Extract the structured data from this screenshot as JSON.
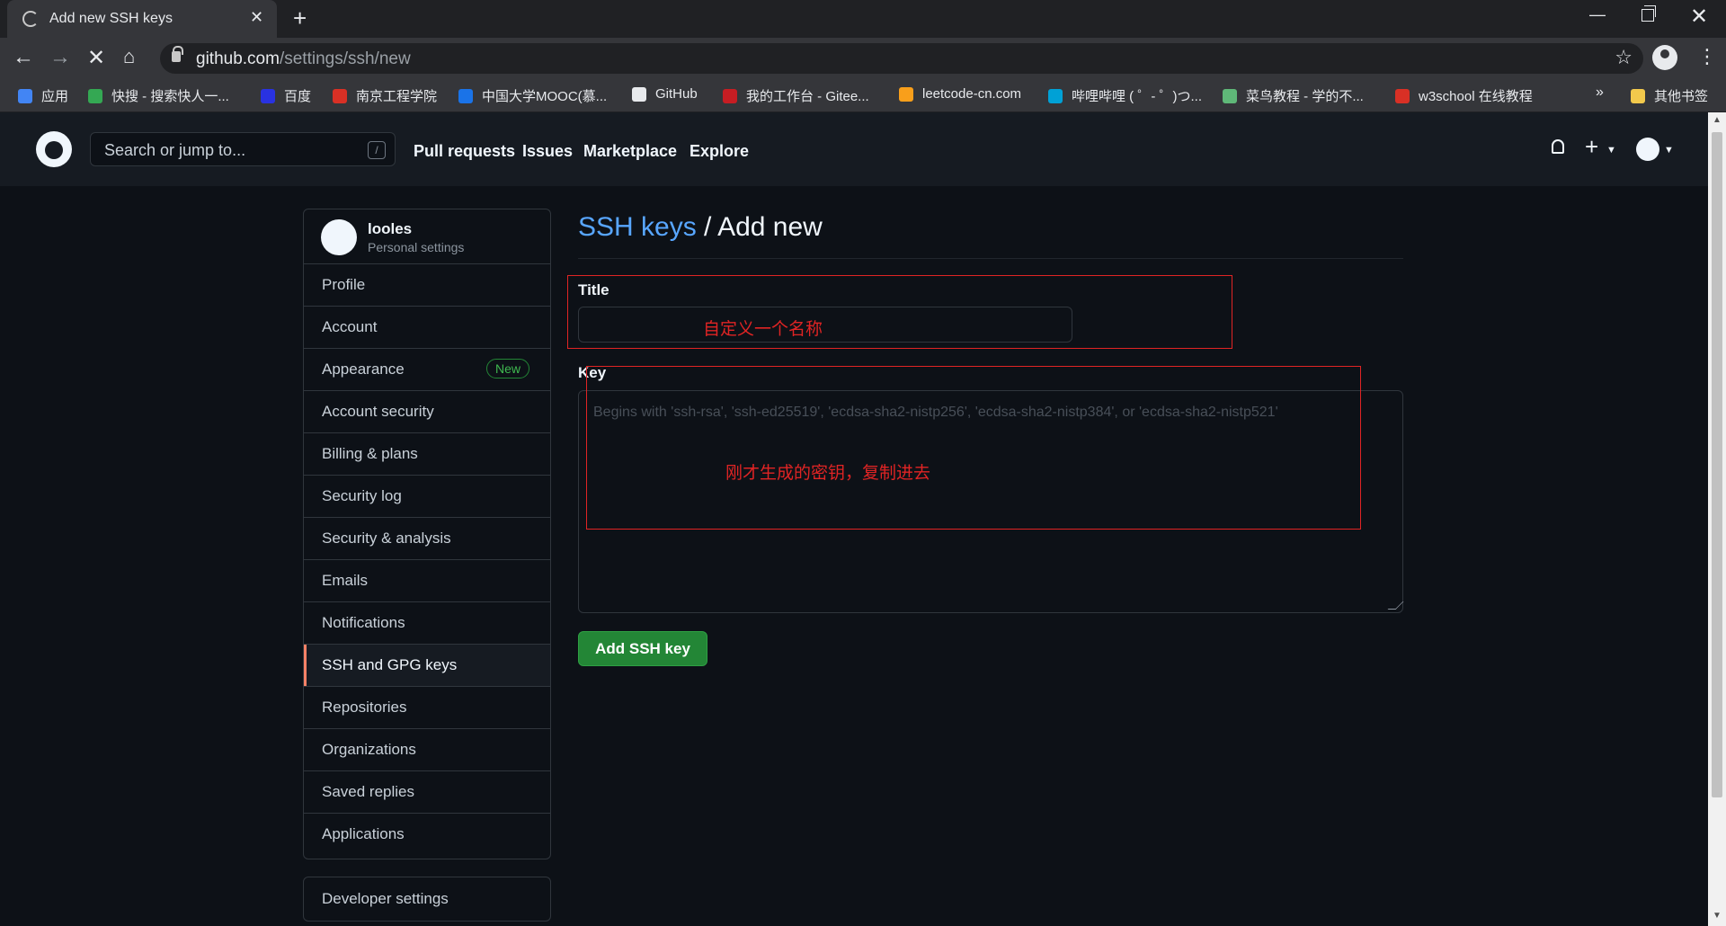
{
  "browser": {
    "tab_title": "Add new SSH keys",
    "tab_close": "✕",
    "new_tab": "+",
    "url_host": "github.com",
    "url_path": "/settings/ssh/new",
    "bookmarks": [
      {
        "label": "应用",
        "color": "#4285f4"
      },
      {
        "label": "快搜 - 搜索快人一...",
        "color": "#34a853"
      },
      {
        "label": "百度",
        "color": "#2932e1"
      },
      {
        "label": "南京工程学院",
        "color": "#d93025"
      },
      {
        "label": "中国大学MOOC(慕...",
        "color": "#1a73e8"
      },
      {
        "label": "GitHub",
        "color": "#e8eaed"
      },
      {
        "label": "我的工作台 - Gitee...",
        "color": "#c71d23"
      },
      {
        "label": "leetcode-cn.com",
        "color": "#f89f1b"
      },
      {
        "label": "哔哩哔哩 ( ゜- ゜)つ...",
        "color": "#00a1d6"
      },
      {
        "label": "菜鸟教程 - 学的不...",
        "color": "#5fb878"
      },
      {
        "label": "w3school 在线教程",
        "color": "#d93025"
      }
    ],
    "bookmarks_more": "»",
    "other_bookmarks": "其他书签"
  },
  "github_header": {
    "search_placeholder": "Search or jump to...",
    "search_shortcut": "/",
    "nav": [
      "Pull requests",
      "Issues",
      "Marketplace",
      "Explore"
    ]
  },
  "sidebar": {
    "username": "looles",
    "subtitle": "Personal settings",
    "items": [
      {
        "label": "Profile"
      },
      {
        "label": "Account"
      },
      {
        "label": "Appearance",
        "badge": "New"
      },
      {
        "label": "Account security"
      },
      {
        "label": "Billing & plans"
      },
      {
        "label": "Security log"
      },
      {
        "label": "Security & analysis"
      },
      {
        "label": "Emails"
      },
      {
        "label": "Notifications"
      },
      {
        "label": "SSH and GPG keys",
        "active": true
      },
      {
        "label": "Repositories"
      },
      {
        "label": "Organizations"
      },
      {
        "label": "Saved replies"
      },
      {
        "label": "Applications"
      }
    ],
    "developer_settings": "Developer settings"
  },
  "main": {
    "breadcrumb_link": "SSH keys",
    "breadcrumb_sep": " / ",
    "breadcrumb_current": "Add new",
    "title_label": "Title",
    "title_value": "",
    "key_label": "Key",
    "key_placeholder": "Begins with 'ssh-rsa', 'ssh-ed25519', 'ecdsa-sha2-nistp256', 'ecdsa-sha2-nistp384', or 'ecdsa-sha2-nistp521'",
    "submit_label": "Add SSH key"
  },
  "annotations": {
    "title_note": "自定义一个名称",
    "key_note": "刚才生成的密钥，复制进去"
  },
  "colors": {
    "link": "#58a6ff",
    "primary_button": "#238636",
    "annotation": "#e02424",
    "active_marker": "#f78166"
  }
}
